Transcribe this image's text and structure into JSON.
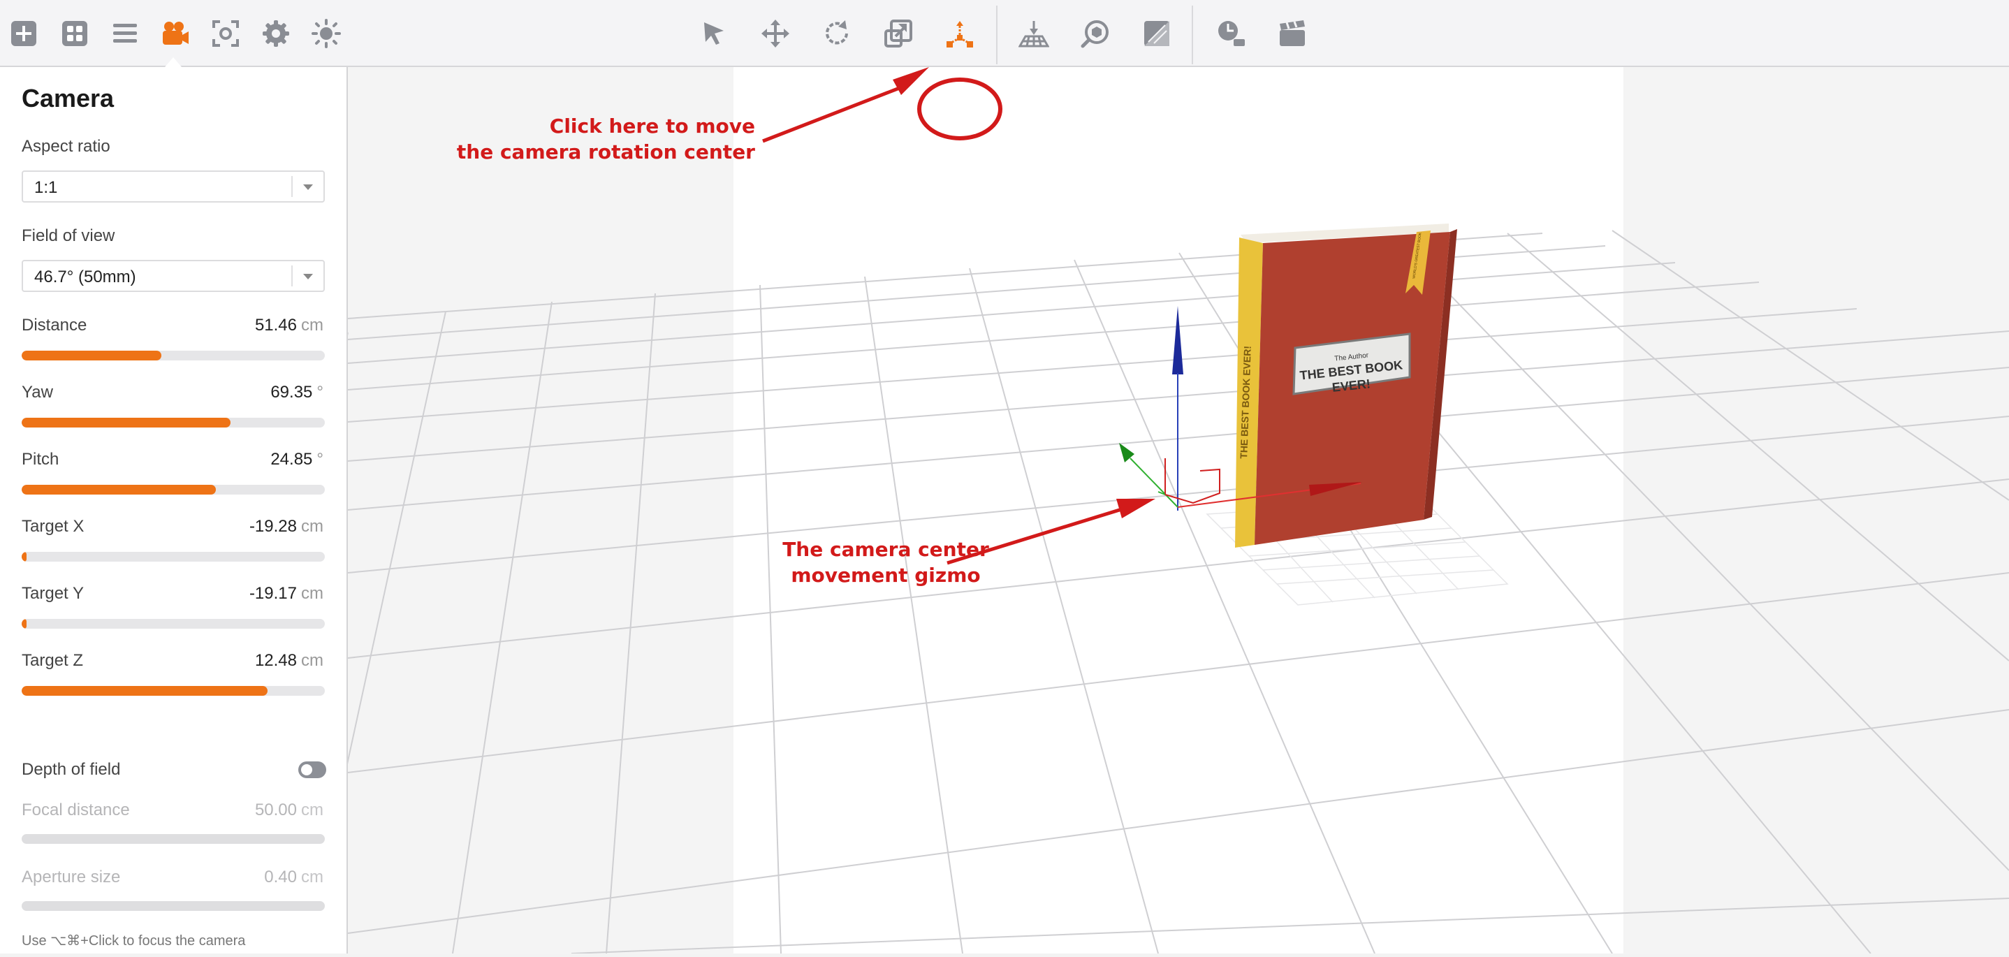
{
  "toolbar": {
    "left_icons": [
      "add-icon",
      "layout-grid-icon",
      "layers-menu-icon",
      "camera-icon",
      "frame-capture-icon",
      "gear-icon",
      "sun-icon"
    ],
    "center_icons": [
      "select-cursor-icon",
      "move-arrows-icon",
      "rotate-icon",
      "scale-icon",
      "camera-center-move-icon",
      "ground-plane-icon",
      "orbit-view-icon",
      "material-icon",
      "timer-icon",
      "clapperboard-icon"
    ],
    "accent": "#ee7316",
    "icon_color": "#8a8d94"
  },
  "sidebar": {
    "title": "Camera",
    "aspect_ratio": {
      "label": "Aspect ratio",
      "value": "1:1"
    },
    "field_of_view": {
      "label": "Field of view",
      "value": "46.7° (50mm)"
    },
    "sliders": [
      {
        "label": "Distance",
        "value": "51.46",
        "unit": "cm",
        "fill": 0.46
      },
      {
        "label": "Yaw",
        "value": "69.35",
        "unit": "°",
        "fill": 0.69
      },
      {
        "label": "Pitch",
        "value": "24.85",
        "unit": "°",
        "fill": 0.64
      },
      {
        "label": "Target X",
        "value": "-19.28",
        "unit": "cm",
        "fill": 0.016
      },
      {
        "label": "Target Y",
        "value": "-19.17",
        "unit": "cm",
        "fill": 0.016
      },
      {
        "label": "Target Z",
        "value": "12.48",
        "unit": "cm",
        "fill": 0.81
      }
    ],
    "depth_of_field": {
      "label": "Depth of field",
      "enabled": false
    },
    "focal_distance": {
      "label": "Focal distance",
      "value": "50.00",
      "unit": "cm"
    },
    "aperture_size": {
      "label": "Aperture size",
      "value": "0.40",
      "unit": "cm"
    },
    "hint": "Use ⌥⌘+Click to focus the camera"
  },
  "viewport": {
    "book": {
      "author": "The Author",
      "title_line1": "THE BEST BOOK",
      "title_line2": "EVER!",
      "spine": "THE BEST BOOK EVER!",
      "ribbon": "WORLD'S GREATEST BOOK"
    },
    "annotation_top_line1": "Click here to move",
    "annotation_top_line2": "the camera rotation center",
    "annotation_bottom_line1": "The camera center",
    "annotation_bottom_line2": "movement gizmo",
    "annotation_color": "#d21a1a"
  }
}
